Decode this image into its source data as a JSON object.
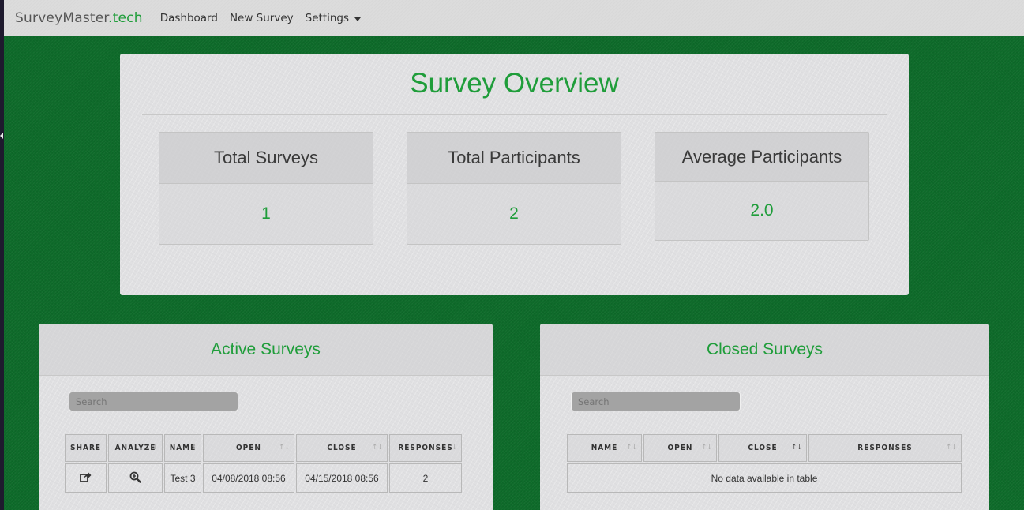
{
  "brand": {
    "name": "SurveyMaster",
    "tld": ".tech"
  },
  "nav": {
    "dashboard": "Dashboard",
    "new_survey": "New Survey",
    "settings": "Settings"
  },
  "overview": {
    "title": "Survey Overview",
    "cards": [
      {
        "label": "Total Surveys",
        "value": "1"
      },
      {
        "label": "Total Participants",
        "value": "2"
      },
      {
        "label": "Average Participants",
        "value": "2.0"
      }
    ]
  },
  "active": {
    "title": "Active Surveys",
    "search_placeholder": "Search",
    "columns": [
      "SHARE",
      "ANALYZE",
      "NAME",
      "OPEN",
      "CLOSE",
      "RESPONSES"
    ],
    "rows": [
      {
        "share_icon": "share-icon",
        "analyze_icon": "zoom-in-icon",
        "name": "Test 3",
        "open": "04/08/2018 08:56",
        "close": "04/15/2018 08:56",
        "responses": "2"
      }
    ]
  },
  "closed": {
    "title": "Closed Surveys",
    "search_placeholder": "Search",
    "columns": [
      "NAME",
      "OPEN",
      "CLOSE",
      "RESPONSES"
    ],
    "empty_text": "No data available in table"
  },
  "colors": {
    "accent": "#1f9d3a",
    "background": "#0e6b2a",
    "panel": "#e0e0e2"
  }
}
